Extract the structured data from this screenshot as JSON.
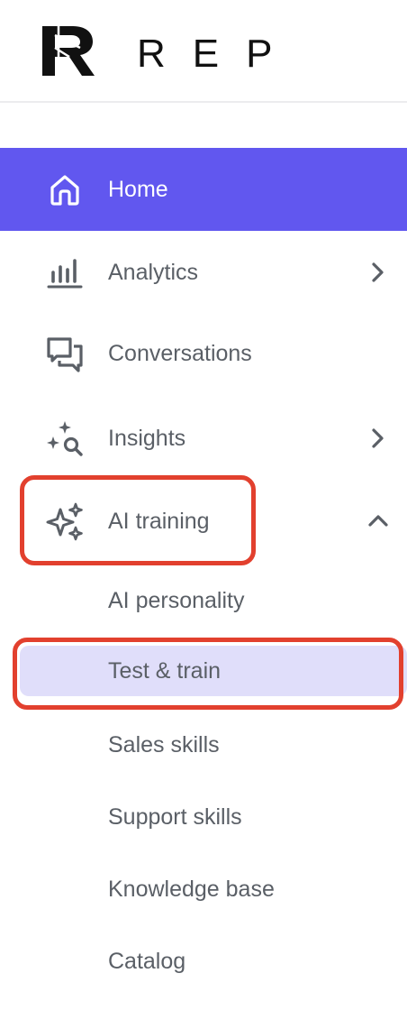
{
  "brand": {
    "name": "REP"
  },
  "nav": {
    "home": {
      "label": "Home",
      "icon": "home-icon"
    },
    "analytics": {
      "label": "Analytics",
      "icon": "bar-chart-icon"
    },
    "conversations": {
      "label": "Conversations",
      "icon": "chat-bubbles-icon"
    },
    "insights": {
      "label": "Insights",
      "icon": "sparkle-search-icon"
    },
    "ai_training": {
      "label": "AI training",
      "icon": "sparkles-icon",
      "expanded": true
    }
  },
  "ai_training_sub": {
    "personality": "AI personality",
    "test_train": "Test & train",
    "sales_skills": "Sales skills",
    "support_skills": "Support skills",
    "knowledge_base": "Knowledge base",
    "catalog": "Catalog"
  },
  "colors": {
    "active_bg": "#6157ef",
    "selected_bg": "#e0defa",
    "highlight": "#e2402e",
    "text": "#5a5f66"
  }
}
